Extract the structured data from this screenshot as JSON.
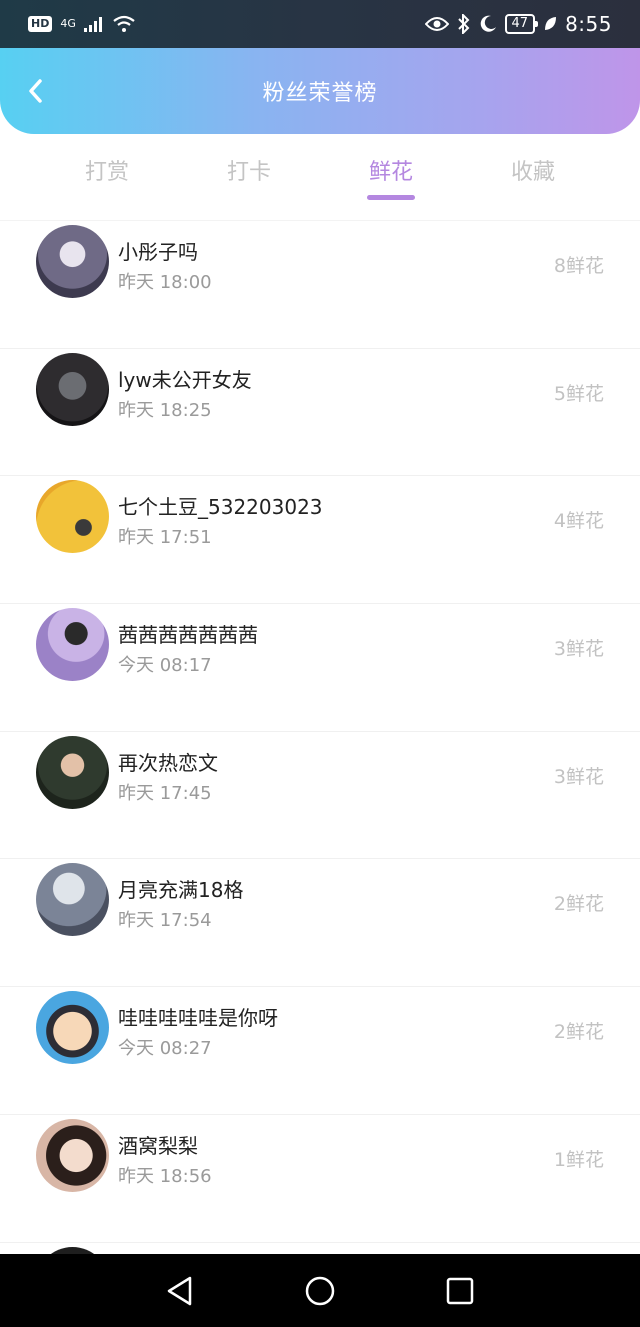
{
  "status_bar": {
    "hd": "HD",
    "network": "4G",
    "battery": "47",
    "time": "8:55"
  },
  "header": {
    "title": "粉丝荣誉榜"
  },
  "tabs": [
    {
      "label": "打赏",
      "active": false
    },
    {
      "label": "打卡",
      "active": false
    },
    {
      "label": "鲜花",
      "active": true
    },
    {
      "label": "收藏",
      "active": false
    }
  ],
  "fans": [
    {
      "name": "小彤子吗",
      "time": "昨天 18:00",
      "amount": "8鲜花",
      "avatar_color": "#6f6a86"
    },
    {
      "name": "lyw未公开女友",
      "time": "昨天 18:25",
      "amount": "5鲜花",
      "avatar_color": "#2e2c2f"
    },
    {
      "name": "七个土豆_532203023",
      "time": "昨天 17:51",
      "amount": "4鲜花",
      "avatar_color": "#f2c23a"
    },
    {
      "name": "茜茜茜茜茜茜茜",
      "time": "今天 08:17",
      "amount": "3鲜花",
      "avatar_color": "#9b82c7"
    },
    {
      "name": "再次热恋文",
      "time": "昨天 17:45",
      "amount": "3鲜花",
      "avatar_color": "#2f3a2e"
    },
    {
      "name": "月亮充满18格",
      "time": "昨天 17:54",
      "amount": "2鲜花",
      "avatar_color": "#7b8497"
    },
    {
      "name": "哇哇哇哇哇是你呀",
      "time": "今天 08:27",
      "amount": "2鲜花",
      "avatar_color": "#4aa6e0"
    },
    {
      "name": "酒窝梨梨",
      "time": "昨天 18:56",
      "amount": "1鲜花",
      "avatar_color": "#d8b6a6"
    }
  ]
}
